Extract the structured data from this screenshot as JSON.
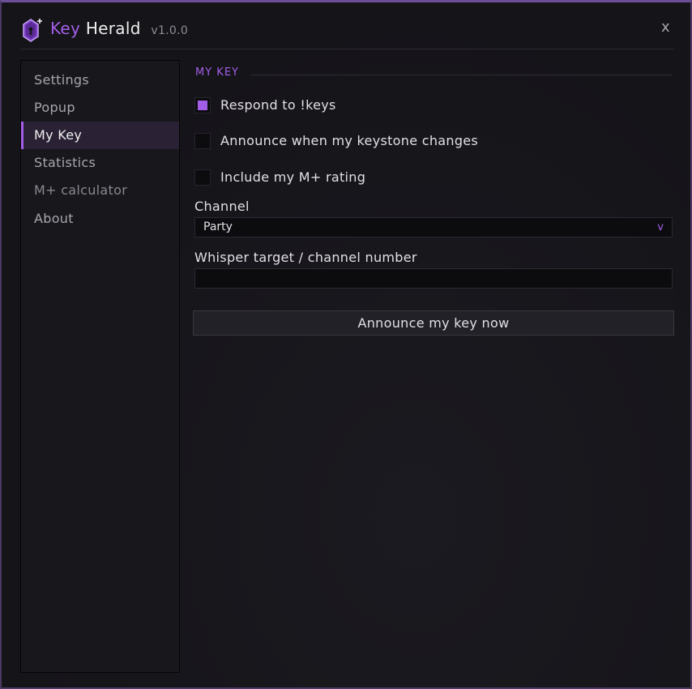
{
  "app": {
    "title_key": "Key",
    "title_name": "Herald",
    "version": "v1.0.0",
    "close_label": "x",
    "logo_icon": "crystal-keystone-icon",
    "accent_color": "#a35ee8"
  },
  "sidebar": {
    "items": [
      {
        "label": "Settings"
      },
      {
        "label": "Popup"
      },
      {
        "label": "My Key",
        "active": true
      },
      {
        "label": "Statistics"
      },
      {
        "label": "M+ calculator"
      },
      {
        "label": "About"
      }
    ]
  },
  "main": {
    "section_title": "MY KEY",
    "checkboxes": [
      {
        "label": "Respond to !keys",
        "checked": true
      },
      {
        "label": "Announce when my keystone changes",
        "checked": false
      },
      {
        "label": "Include my M+ rating",
        "checked": false
      }
    ],
    "channel": {
      "label": "Channel",
      "value": "Party",
      "arrow": "v"
    },
    "whisper": {
      "label": "Whisper target / channel number",
      "value": ""
    },
    "announce_button": "Announce my key now"
  }
}
